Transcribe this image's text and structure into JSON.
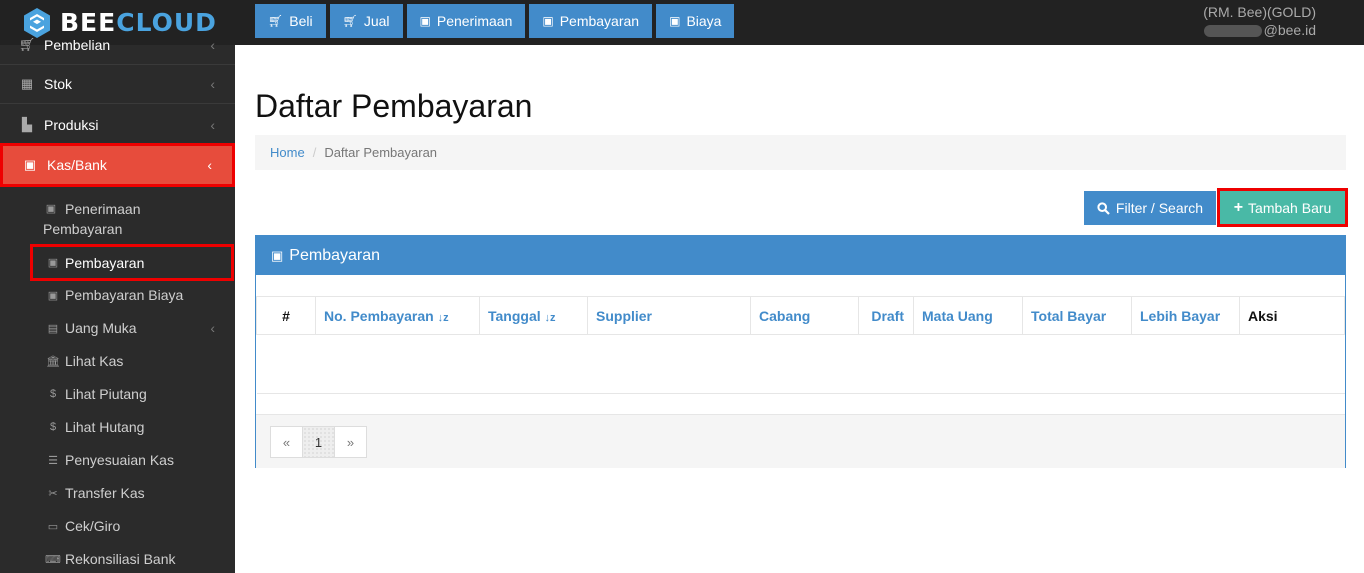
{
  "brand": {
    "prefix": "BEE",
    "suffix": "CLOUD"
  },
  "topnav": [
    {
      "label": "Beli",
      "icon": "cart-icon"
    },
    {
      "label": "Jual",
      "icon": "cart-icon"
    },
    {
      "label": "Penerimaan",
      "icon": "money-icon"
    },
    {
      "label": "Pembayaran",
      "icon": "money-icon"
    },
    {
      "label": "Biaya",
      "icon": "money-icon"
    }
  ],
  "user": {
    "company": "(RM. Bee)(GOLD)",
    "email_suffix": "@bee.id"
  },
  "sidebar": {
    "items": [
      {
        "label": "Pembelian",
        "icon": "cart-icon"
      },
      {
        "label": "Stok",
        "icon": "box-icon"
      },
      {
        "label": "Produksi",
        "icon": "factory-icon"
      },
      {
        "label": "Kas/Bank",
        "icon": "money-icon"
      }
    ],
    "sub_items": [
      {
        "label_line1": "Penerimaan",
        "label_line2": "Pembayaran",
        "icon": "money-icon"
      },
      {
        "label": "Pembayaran",
        "icon": "money-icon"
      },
      {
        "label": "Pembayaran Biaya",
        "icon": "money-icon"
      },
      {
        "label": "Uang Muka",
        "icon": "file-icon"
      },
      {
        "label": "Lihat Kas",
        "icon": "bank-icon"
      },
      {
        "label": "Lihat Piutang",
        "icon": "dollar-icon"
      },
      {
        "label": "Lihat Hutang",
        "icon": "dollar-icon"
      },
      {
        "label": "Penyesuaian Kas",
        "icon": "list-icon"
      },
      {
        "label": "Transfer Kas",
        "icon": "scissors-icon"
      },
      {
        "label": "Cek/Giro",
        "icon": "card-icon"
      },
      {
        "label": "Rekonsiliasi Bank",
        "icon": "keyboard-icon"
      }
    ]
  },
  "page": {
    "title": "Daftar Pembayaran"
  },
  "breadcrumb": {
    "home": "Home",
    "current": "Daftar Pembayaran"
  },
  "actions": {
    "filter": "Filter / Search",
    "add": "Tambah Baru"
  },
  "panel": {
    "title": "Pembayaran"
  },
  "table": {
    "columns": [
      "#",
      "No. Pembayaran",
      "Tanggal",
      "Supplier",
      "Cabang",
      "Draft",
      "Mata Uang",
      "Total Bayar",
      "Lebih Bayar",
      "Aksi"
    ]
  },
  "pagination": {
    "prev": "«",
    "page": "1",
    "next": "»"
  },
  "colors": {
    "primary": "#428bca",
    "success": "#49b9a6",
    "danger": "#e74c3c",
    "highlight": "#ee0000"
  }
}
